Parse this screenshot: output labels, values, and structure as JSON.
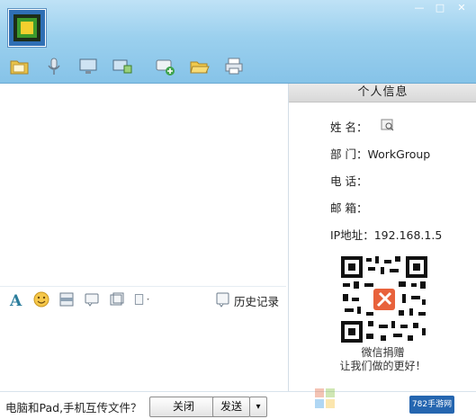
{
  "window": {
    "minimize_glyph": "—",
    "maximize_glyph": "□",
    "close_glyph": "✕"
  },
  "toolbar": {
    "icons": [
      "folder-icon",
      "microphone-icon",
      "monitor-icon",
      "remote-desktop-icon",
      "add-chat-icon",
      "open-folder-icon",
      "printer-icon"
    ]
  },
  "format_bar": {
    "history_label": "历史记录"
  },
  "profile": {
    "header": "个人信息",
    "name_label": "姓 名：",
    "dept_label": "部 门：",
    "dept_value": "WorkGroup",
    "phone_label": "电 话：",
    "email_label": "邮 箱：",
    "ip_label": "IP地址：",
    "ip_value": "192.168.1.5",
    "donate_line1": "微信捐赠",
    "donate_line2": "让我们做的更好！"
  },
  "footer": {
    "hint": "电脑和Pad,手机互传文件？",
    "close_label": "关闭",
    "send_label": "发送",
    "dropdown_glyph": "▾"
  },
  "branding": {
    "site_badge": "782手游网",
    "accent": "#2566b0"
  },
  "colors": {
    "header_top": "#bfe2f6",
    "header_bottom": "#86c3e8"
  }
}
